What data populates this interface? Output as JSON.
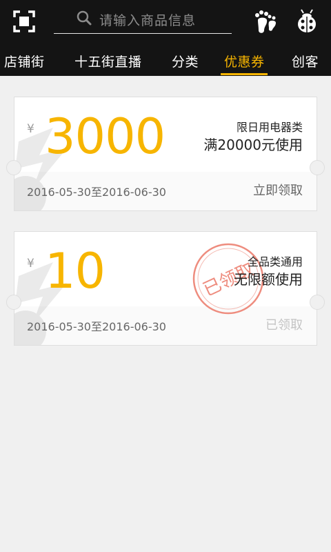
{
  "header": {
    "search_placeholder": "请输入商品信息",
    "icons": [
      "scan-icon",
      "search-icon",
      "footprint-icon",
      "ladybug-icon"
    ]
  },
  "tabs": [
    {
      "label": "店铺街",
      "active": false
    },
    {
      "label": "十五街直播",
      "active": false
    },
    {
      "label": "分类",
      "active": false
    },
    {
      "label": "优惠券",
      "active": true
    },
    {
      "label": "创客",
      "active": false
    }
  ],
  "coupons": [
    {
      "currency": "¥",
      "amount": "3000",
      "category": "限日用电器类",
      "condition": "满20000元使用",
      "dates": "2016-05-30至2016-06-30",
      "action": "立即领取",
      "claimed": false
    },
    {
      "currency": "¥",
      "amount": "10",
      "category": "全品类通用",
      "condition": "无限额使用",
      "dates": "2016-05-30至2016-06-30",
      "action": "已领取",
      "claimed": true,
      "stamp": "已领取"
    }
  ],
  "colors": {
    "accent": "#f7b500",
    "header_bg": "#141414",
    "page_bg": "#f0f0f0",
    "stamp": "#ee8c7e"
  }
}
